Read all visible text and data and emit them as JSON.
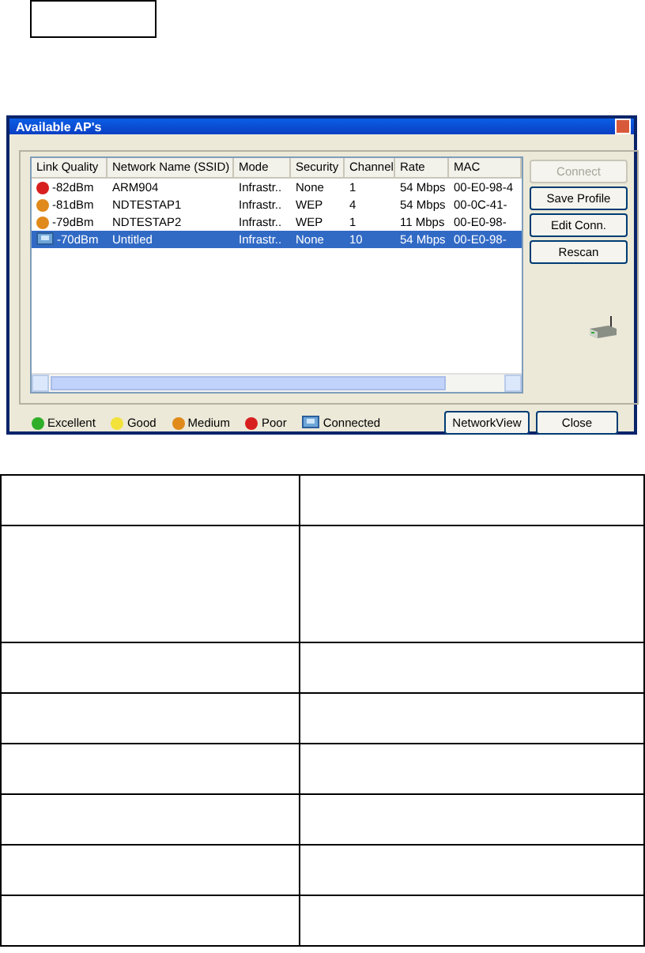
{
  "window": {
    "title": "Available AP's"
  },
  "table": {
    "columns": [
      "Link Quality",
      "Network Name (SSID)",
      "Mode",
      "Security",
      "Channel",
      "Rate",
      "MAC"
    ],
    "rows": [
      {
        "kind": "poor",
        "selected": false,
        "cells": [
          "-82dBm",
          "ARM904",
          "Infrastr..",
          "None",
          "1",
          "54 Mbps",
          "00-E0-98-4"
        ]
      },
      {
        "kind": "medium",
        "selected": false,
        "cells": [
          "-81dBm",
          "NDTESTAP1",
          "Infrastr..",
          "WEP",
          "4",
          "54 Mbps",
          "00-0C-41-"
        ]
      },
      {
        "kind": "medium",
        "selected": false,
        "cells": [
          "-79dBm",
          "NDTESTAP2",
          "Infrastr..",
          "WEP",
          "1",
          "11 Mbps",
          "00-E0-98-"
        ]
      },
      {
        "kind": "connected",
        "selected": true,
        "cells": [
          "-70dBm",
          "Untitled",
          "Infrastr..",
          "None",
          "10",
          "54 Mbps",
          "00-E0-98-"
        ]
      }
    ]
  },
  "side_buttons": [
    {
      "label": "Connect",
      "disabled": true
    },
    {
      "label": "Save Profile",
      "disabled": false
    },
    {
      "label": "Edit Conn.",
      "disabled": false
    },
    {
      "label": "Rescan",
      "disabled": false
    }
  ],
  "legend": [
    {
      "kind": "excellent",
      "label": "Excellent"
    },
    {
      "kind": "good",
      "label": "Good"
    },
    {
      "kind": "medium",
      "label": "Medium"
    },
    {
      "kind": "poor",
      "label": "Poor"
    },
    {
      "kind": "connected",
      "label": "Connected"
    }
  ],
  "bottom_buttons": [
    "NetworkView",
    "Close"
  ]
}
